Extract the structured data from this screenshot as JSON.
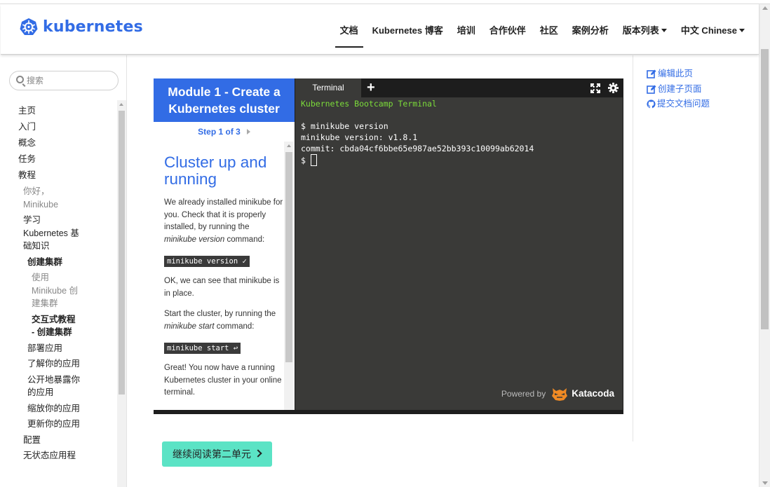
{
  "brand": {
    "name": "kubernetes",
    "color": "#326ce5"
  },
  "nav": {
    "items": [
      {
        "label": "文档",
        "active": true
      },
      {
        "label": "Kubernetes 博客"
      },
      {
        "label": "培训"
      },
      {
        "label": "合作伙伴"
      },
      {
        "label": "社区"
      },
      {
        "label": "案例分析"
      },
      {
        "label": "版本列表",
        "dropdown": true
      },
      {
        "label": "中文 Chinese",
        "dropdown": true
      }
    ]
  },
  "search": {
    "placeholder": "搜索"
  },
  "sidebar": {
    "items": [
      {
        "label": "主页",
        "level": 0
      },
      {
        "label": "入门",
        "level": 0
      },
      {
        "label": "概念",
        "level": 0
      },
      {
        "label": "任务",
        "level": 0
      },
      {
        "label": "教程",
        "level": 0
      },
      {
        "label": "你好，Minikube",
        "level": 1,
        "muted": true
      },
      {
        "label": "学习 Kubernetes 基础知识",
        "level": 1
      },
      {
        "label": "创建集群",
        "level": 2,
        "bold": true
      },
      {
        "label": "使用 Minikube 创建集群",
        "level": 3,
        "muted": true
      },
      {
        "label": "交互式教程 - 创建集群",
        "level": 3,
        "bold": true
      },
      {
        "label": "部署应用",
        "level": 2
      },
      {
        "label": "了解你的应用",
        "level": 2
      },
      {
        "label": "公开地暴露你的应用",
        "level": 2
      },
      {
        "label": "缩放你的应用",
        "level": 2
      },
      {
        "label": "更新你的应用",
        "level": 2
      },
      {
        "label": "配置",
        "level": 1
      },
      {
        "label": "无状态应用程",
        "level": 1
      }
    ]
  },
  "tutorial": {
    "module_title": "Module 1 - Create a Kubernetes cluster",
    "step": "Step 1 of 3",
    "heading": "Cluster up and running",
    "p1_a": "We already installed minikube for you. Check that it is properly installed, by running the ",
    "p1_em": "minikube version",
    "p1_b": " command:",
    "code1": "minikube version ✓",
    "p2": "OK, we can see that minikube is in place.",
    "p3_a": "Start the cluster, by running the ",
    "p3_em": "minikube start",
    "p3_b": " command:",
    "code2": "minikube start ↩",
    "p4": "Great! You now have a running Kubernetes cluster in your online terminal."
  },
  "terminal": {
    "tab_label": "Terminal",
    "plus": "+",
    "banner": "Kubernetes Bootcamp Terminal",
    "lines": [
      "$ minikube version",
      "minikube version: v1.8.1",
      "commit: cbda04cf6bbe65e987ae52bb393c10099ab62014"
    ],
    "prompt": "$ ",
    "powered_by": "Powered by",
    "provider": "Katacoda",
    "colors": {
      "background": "#3a3a38",
      "banner": "#7cdc3a"
    }
  },
  "continue_button": {
    "label": "继续阅读第二单元",
    "color": "#5be3c5"
  },
  "right_actions": [
    {
      "label": "编辑此页",
      "icon": "edit-icon"
    },
    {
      "label": "创建子页面",
      "icon": "edit-icon"
    },
    {
      "label": "提交文档问题",
      "icon": "github-icon"
    }
  ]
}
